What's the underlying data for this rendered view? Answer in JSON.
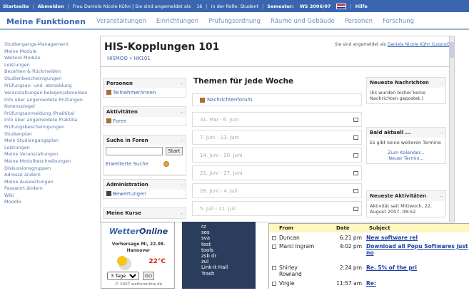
{
  "topbar": {
    "items": [
      "Startseite",
      "Abmelden",
      "Frau Daniela Nicole Kühn | Sie sind angemeldet als",
      "16",
      "in der Rolle: Student",
      "Semester:",
      "WS 2006/07",
      "Hilfe"
    ],
    "left_item_1": "Startseite",
    "left_item_2": "Abmelden",
    "user": "Frau Daniela Nicole Kühn | Sie sind angemeldet als",
    "number": "16",
    "role": "in der Rolle: Student",
    "semester_label": "Semester:",
    "semester_value": "WS 2006/07",
    "help": "Hilfe"
  },
  "mainnav": {
    "title": "Meine Funktionen",
    "links": [
      "Veranstaltungen",
      "Einrichtungen",
      "Prüfungsordnung",
      "Räume und Gebäude",
      "Personen",
      "Forschung"
    ]
  },
  "leftnav": {
    "items": [
      "Studiengangs-Management",
      "Meine Module",
      "Weitere Module",
      "Leistungen",
      "Bezahlen & Rückmelden",
      "Studienbescheinigungen",
      "Prüfungsan- und -abmeldung",
      "Veranstaltungen belegen/abmelden",
      "Info über angemeldete Prüfungen",
      "Notenspiegel",
      "Prüfungsanmeldung (Praktika)",
      "Info über angemeldete Praktika",
      "Prüfungsbescheinigungen",
      "Studienplan",
      "Mein Studiengangsplan",
      "Leistungen",
      "Meine Veranstaltungen",
      "Meine Modulbeschreibungen",
      "Diskussionsgruppen",
      "Adresse ändern",
      "Meine Auswertungen",
      "Passwort ändern",
      "Wiki",
      "Moodle"
    ]
  },
  "moodle": {
    "title": "HIS-Kopplungen 101",
    "login_text": "Sie sind angemeldet als",
    "login_user": "Daniela Nicole Kühn (Logout)",
    "breadcrumb_course": "HISMOO",
    "breadcrumb_arrow": "»",
    "breadcrumb_page": "HK101",
    "blocks": {
      "people_title": "Personen",
      "people_link": "Teilnehmer/innen",
      "activities_title": "Aktivitäten",
      "activities_link": "Foren",
      "search_title": "Suche in Foren",
      "search_button": "Start",
      "search_advanced": "Erweiterte Suche",
      "admin_title": "Administration",
      "admin_link": "Bewertungen",
      "courses_title": "Meine Kurse"
    },
    "topics_title": "Themen für jede Woche",
    "news_forum": "Nachrichtenforum",
    "weeks": [
      "31. Mai - 6. Juni",
      "7. Juni - 13. Juni",
      "14. Juni - 20. Juni",
      "21. Juni - 27. Juni",
      "28. Juni - 4. Juli",
      "5. Juli - 11. Juli"
    ],
    "right": {
      "news_title": "Neueste Nachrichten",
      "news_body": "(Es wurden bisher keine Nachrichten gepostet.)",
      "upcoming_title": "Bald aktuell ...",
      "upcoming_body": "Es gibt keine weiteren Termine",
      "upcoming_link1": "Zum Kalender...",
      "upcoming_link2": "Neuer Termin...",
      "activity_title": "Neueste Aktivitäten",
      "activity_body": "Aktivität seit Mittwoch, 22. August 2007, 08:52"
    }
  },
  "weather": {
    "brand_a": "Wetter",
    "brand_b": "Online",
    "forecast": "Vorhersage Mi, 22.08.",
    "city": "Hannover",
    "temp": "22°C",
    "select_value": "3 Tage",
    "go": "GO",
    "copyright": "© 2007 wetteronline.de"
  },
  "dark_list": [
    "rz",
    "sos",
    "sva",
    "test",
    "tools",
    "zsb dr",
    "zul",
    "Link-it Hall",
    "Trash"
  ],
  "mail": {
    "headers": {
      "from": "From",
      "date": "Date",
      "subject": "Subject"
    },
    "rows": [
      {
        "from": "Duncan",
        "date": "6:21 pm",
        "subject": "New software rel"
      },
      {
        "from": "Marci Ingram",
        "date": "4:02 pm",
        "subject": "Download all Popu Softwares just no"
      },
      {
        "from": "Shirley Rowland",
        "date": "2:24 pm",
        "subject": "Re. 5% of the pri"
      },
      {
        "from": "Virgie",
        "date": "11:57 am",
        "subject": "Re:"
      }
    ]
  },
  "colors": {
    "topbar": "#3a66b0",
    "accent": "#3a66b0",
    "link": "#1a3fa8",
    "mail_header": "#fff6c0",
    "dark_panel": "#2b3d5c"
  }
}
